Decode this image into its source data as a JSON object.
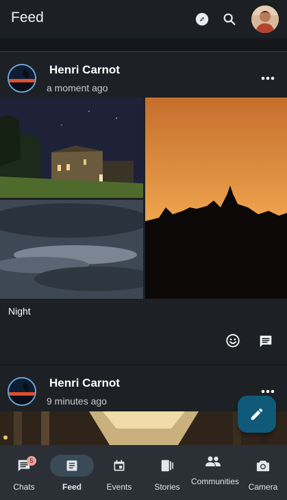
{
  "appbar": {
    "title": "Feed",
    "explore_icon": "explore-icon",
    "search_icon": "search-icon"
  },
  "posts": [
    {
      "author": "Henri Carnot",
      "time": "a moment ago",
      "text": "Night",
      "more_icon": "more-horiz-icon",
      "react_icon": "emoji-icon",
      "comment_icon": "comment-icon"
    },
    {
      "author": "Henri Carnot",
      "time": "9 minutes ago",
      "more_icon": "more-horiz-icon"
    }
  ],
  "fab": {
    "icon": "edit-pencil-icon",
    "color": "#0e5a78"
  },
  "bottom_nav": {
    "items": [
      {
        "label": "Chats",
        "icon": "chat-icon",
        "badge": "5"
      },
      {
        "label": "Feed",
        "icon": "article-icon",
        "active": true
      },
      {
        "label": "Events",
        "icon": "calendar-icon"
      },
      {
        "label": "Stories",
        "icon": "stories-icon"
      },
      {
        "label": "Communities",
        "icon": "people-icon"
      },
      {
        "label": "Camera",
        "icon": "camera-icon"
      }
    ]
  },
  "colors": {
    "background": "#1c1f23",
    "nav_background": "#2b3036",
    "active_pill": "#3b4a57",
    "badge": "#f2a09a",
    "avatar_ring": "#6fa6d9"
  }
}
